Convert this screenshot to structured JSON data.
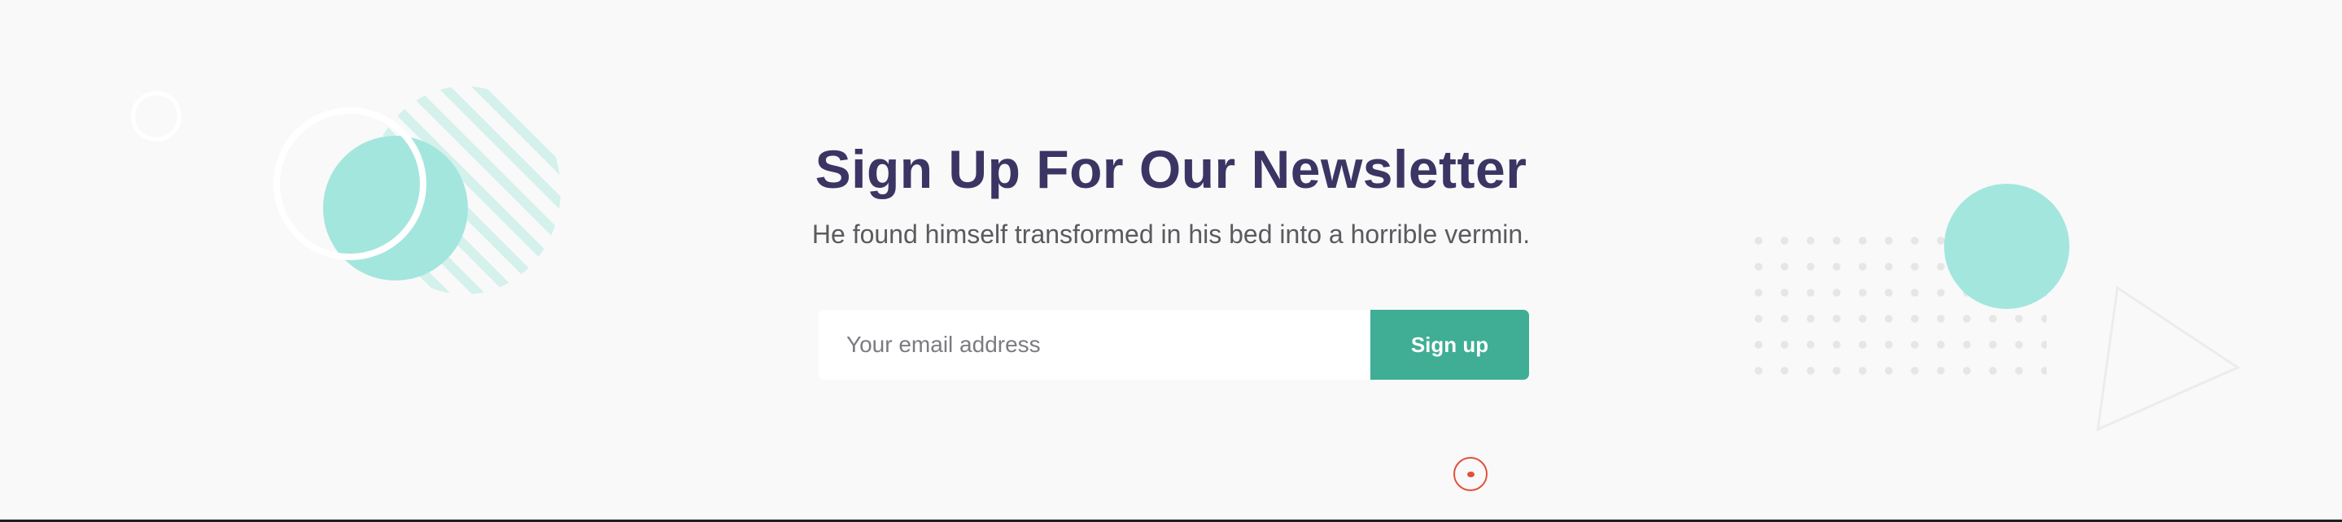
{
  "newsletter": {
    "title": "Sign Up For Our Newsletter",
    "subtitle": "He found himself transformed in his bed into a horrible vermin.",
    "email_placeholder": "Your email address",
    "email_value": "",
    "signup_label": "Sign up"
  },
  "colors": {
    "title": "#3b3564",
    "accent": "#3fae95",
    "decor_teal": "#a3e6dd",
    "background": "#f9f9f9",
    "scroll_indicator": "#e2503a"
  },
  "icons": {
    "scroll_indicator": "scroll-down-indicator-icon"
  }
}
